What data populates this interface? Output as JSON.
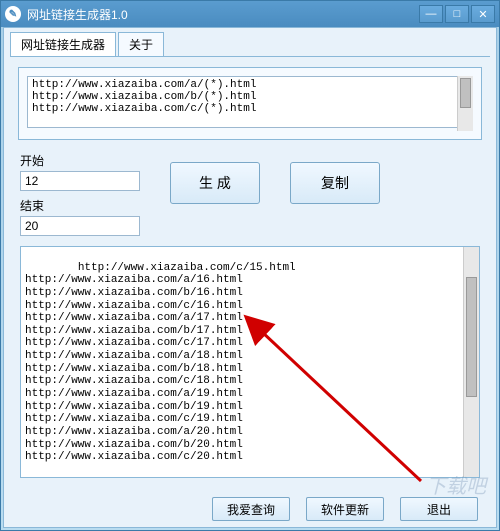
{
  "window": {
    "title": "网址链接生成器1.0"
  },
  "tabs": {
    "t1": "网址链接生成器",
    "t2": "关于"
  },
  "input": {
    "templates": "http://www.xiazaiba.com/a/(*).html\nhttp://www.xiazaiba.com/b/(*).html\nhttp://www.xiazaiba.com/c/(*).html"
  },
  "form": {
    "start_label": "开始",
    "start_value": "12",
    "end_label": "结束",
    "end_value": "20",
    "generate": "生 成",
    "copy": "复制"
  },
  "output": {
    "lines": "http://www.xiazaiba.com/c/15.html\nhttp://www.xiazaiba.com/a/16.html\nhttp://www.xiazaiba.com/b/16.html\nhttp://www.xiazaiba.com/c/16.html\nhttp://www.xiazaiba.com/a/17.html\nhttp://www.xiazaiba.com/b/17.html\nhttp://www.xiazaiba.com/c/17.html\nhttp://www.xiazaiba.com/a/18.html\nhttp://www.xiazaiba.com/b/18.html\nhttp://www.xiazaiba.com/c/18.html\nhttp://www.xiazaiba.com/a/19.html\nhttp://www.xiazaiba.com/b/19.html\nhttp://www.xiazaiba.com/c/19.html\nhttp://www.xiazaiba.com/a/20.html\nhttp://www.xiazaiba.com/b/20.html\nhttp://www.xiazaiba.com/c/20.html"
  },
  "bottom": {
    "query": "我爱查询",
    "update": "软件更新",
    "exit": "退出"
  },
  "watermark": "下载吧"
}
